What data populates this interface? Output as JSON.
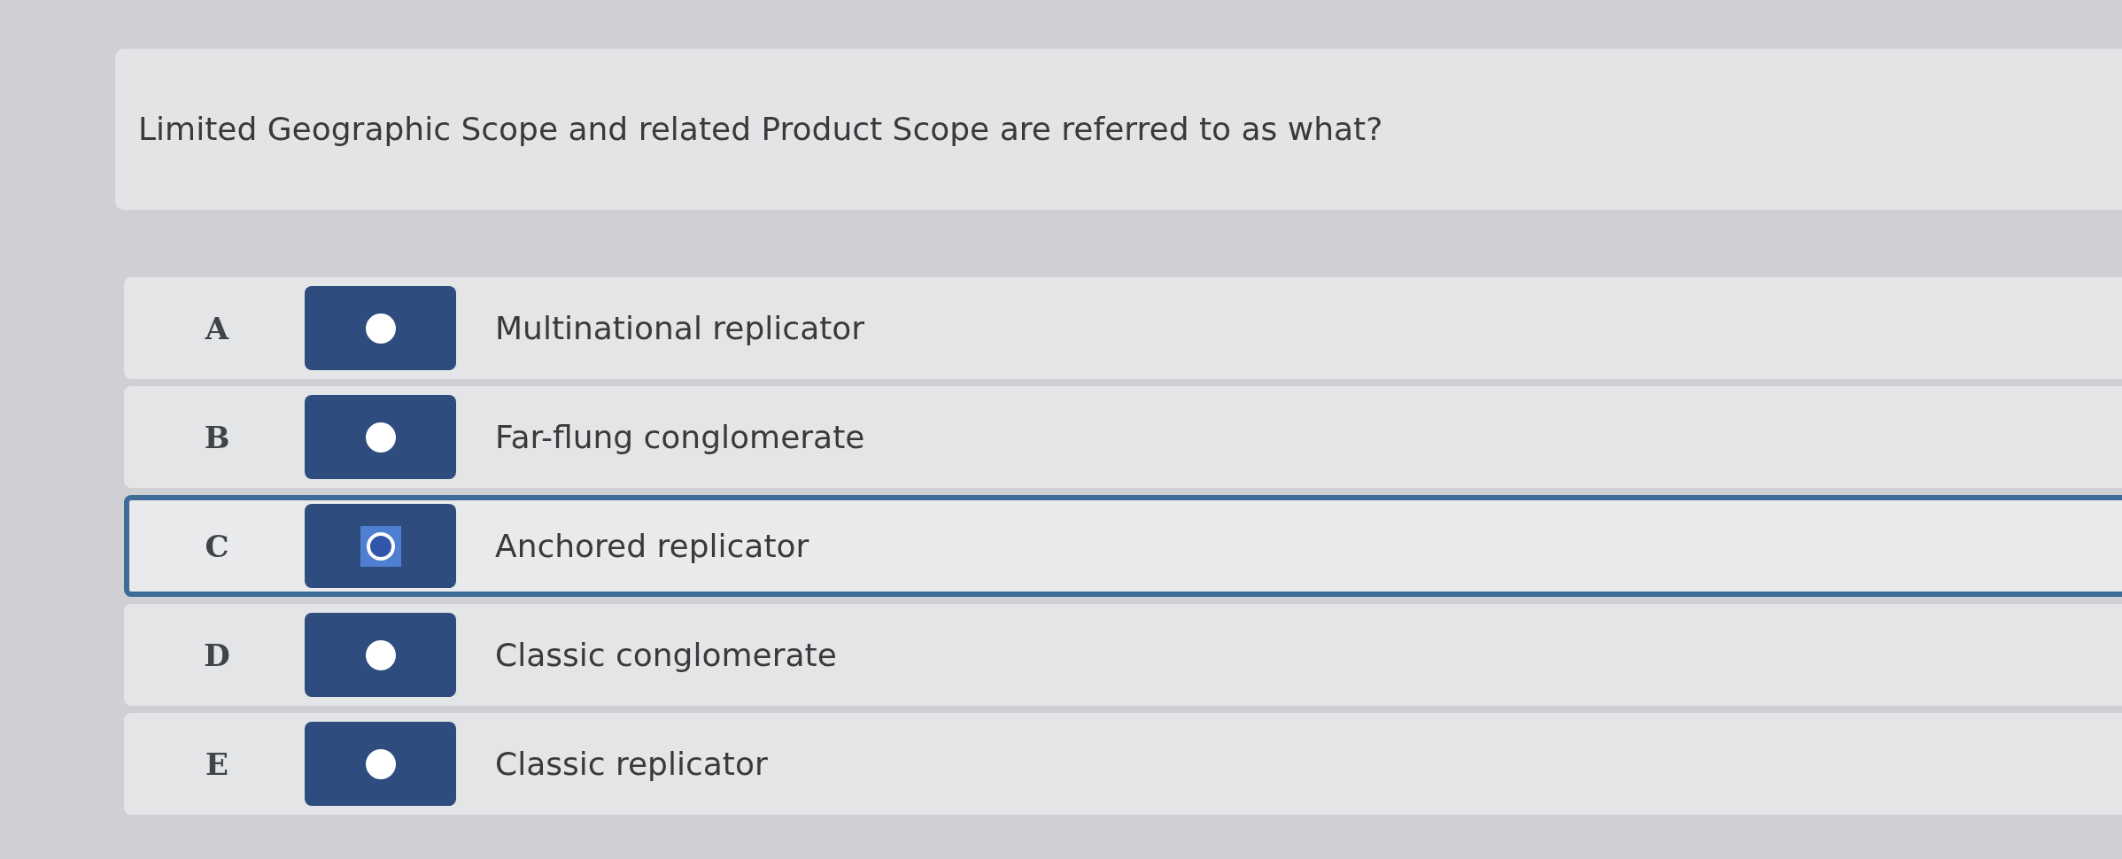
{
  "question": {
    "text": "Limited Geographic Scope and related Product Scope are referred to as what?"
  },
  "options": [
    {
      "letter": "A",
      "text": "Multinational replicator",
      "selected": false,
      "focused": false
    },
    {
      "letter": "B",
      "text": "Far-flung conglomerate",
      "selected": false,
      "focused": false
    },
    {
      "letter": "C",
      "text": "Anchored replicator",
      "selected": false,
      "focused": true
    },
    {
      "letter": "D",
      "text": "Classic conglomerate",
      "selected": false,
      "focused": false
    },
    {
      "letter": "E",
      "text": "Classic replicator",
      "selected": false,
      "focused": false
    }
  ]
}
